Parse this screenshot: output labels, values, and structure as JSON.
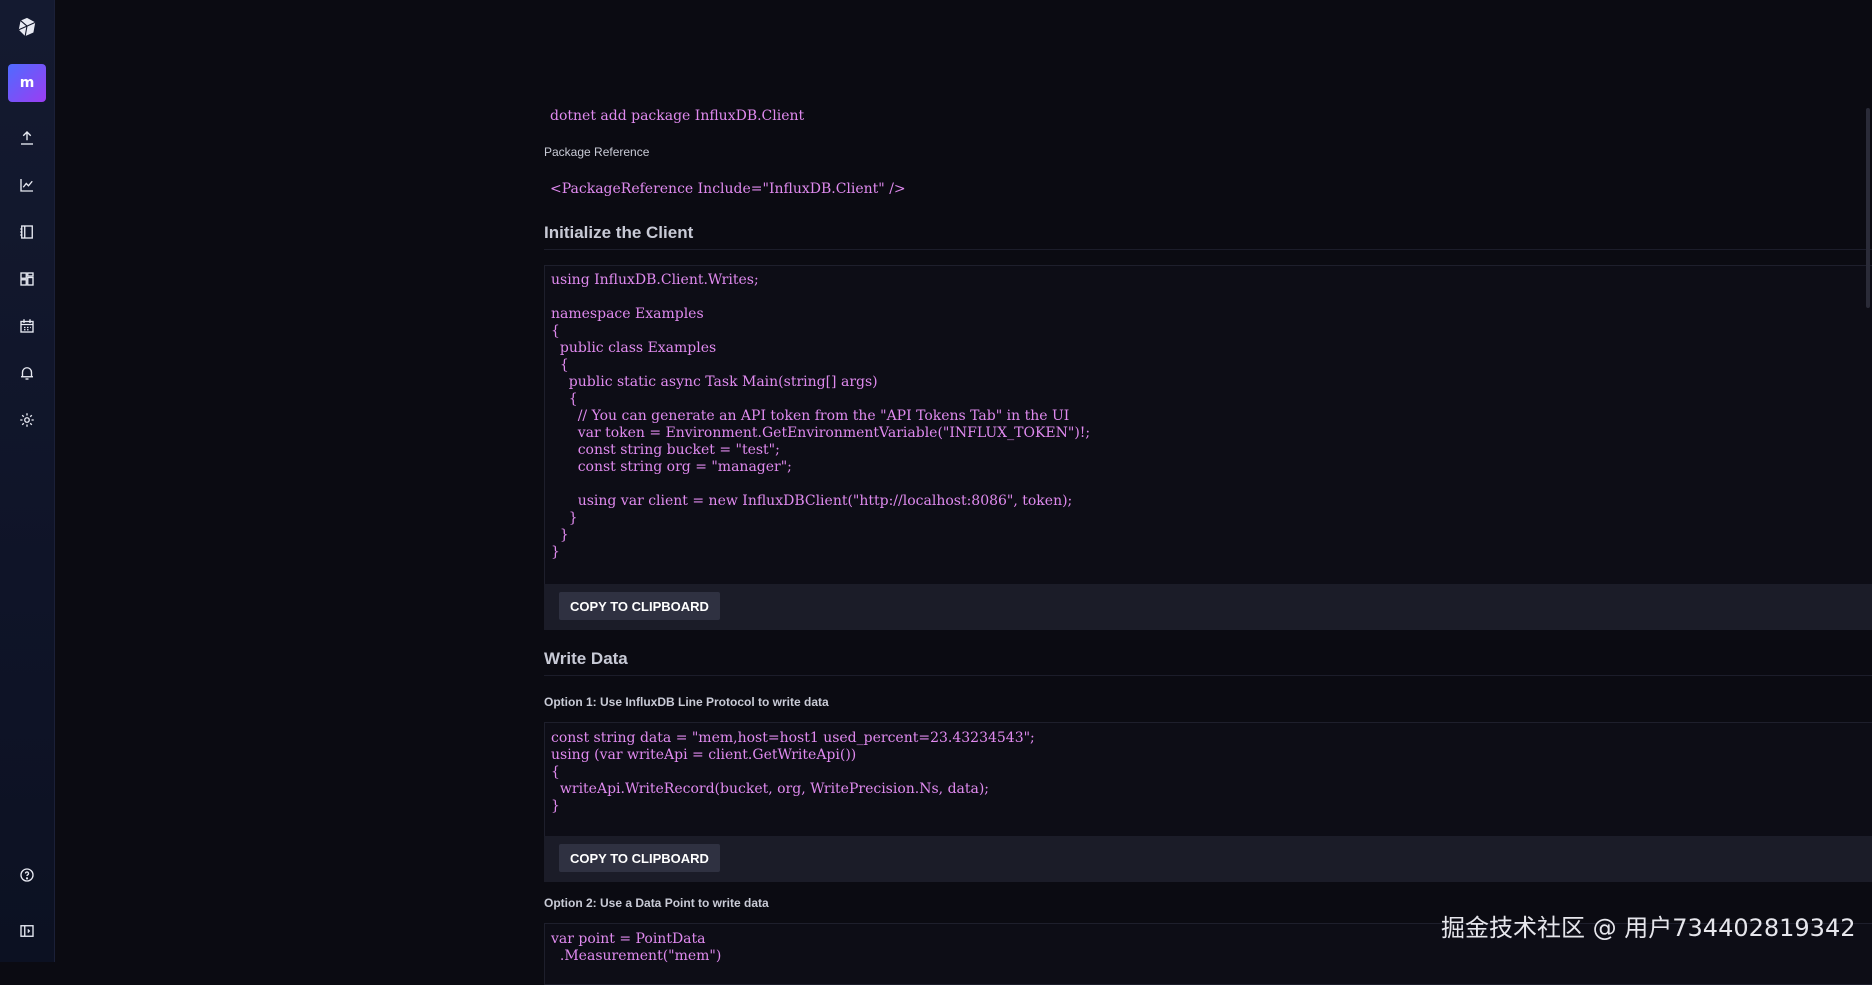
{
  "sidebar": {
    "avatar_letter": "m",
    "items": [
      {
        "icon": "upload-icon"
      },
      {
        "icon": "chart-icon"
      },
      {
        "icon": "notebook-icon"
      },
      {
        "icon": "dashboards-icon"
      },
      {
        "icon": "calendar-icon"
      },
      {
        "icon": "bell-icon"
      },
      {
        "icon": "gear-icon"
      },
      {
        "icon": "help-icon"
      },
      {
        "icon": "collapse-icon"
      }
    ]
  },
  "install": {
    "command": "dotnet add package InfluxDB.Client",
    "package_reference_label": "Package Reference",
    "package_reference_code": "<PackageReference Include=\"InfluxDB.Client\" />"
  },
  "initialize": {
    "title": "Initialize the Client",
    "code": "using InfluxDB.Client.Writes;\n\nnamespace Examples\n{\n  public class Examples\n  {\n    public static async Task Main(string[] args)\n    {\n      // You can generate an API token from the \"API Tokens Tab\" in the UI\n      var token = Environment.GetEnvironmentVariable(\"INFLUX_TOKEN\")!;\n      const string bucket = \"test\";\n      const string org = \"manager\";\n\n      using var client = new InfluxDBClient(\"http://localhost:8086\", token);\n    }\n  }\n}",
    "copy_label": "COPY TO CLIPBOARD"
  },
  "write_data": {
    "title": "Write Data",
    "option1_label": "Option 1: Use InfluxDB Line Protocol to write data",
    "option1_code": "const string data = \"mem,host=host1 used_percent=23.43234543\";\nusing (var writeApi = client.GetWriteApi())\n{\n  writeApi.WriteRecord(bucket, org, WritePrecision.Ns, data);\n}",
    "copy_label": "COPY TO CLIPBOARD",
    "option2_label": "Option 2: Use a Data Point to write data",
    "option2_code": "var point = PointData\n  .Measurement(\"mem\")"
  },
  "watermark": "掘金技术社区 @ 用户734402819342",
  "colors": {
    "code_text": "#e08aef",
    "background": "#0b0b12",
    "sidebar": "#12162a",
    "copy_bar": "#1b1c28",
    "copy_button": "#2f3141"
  }
}
